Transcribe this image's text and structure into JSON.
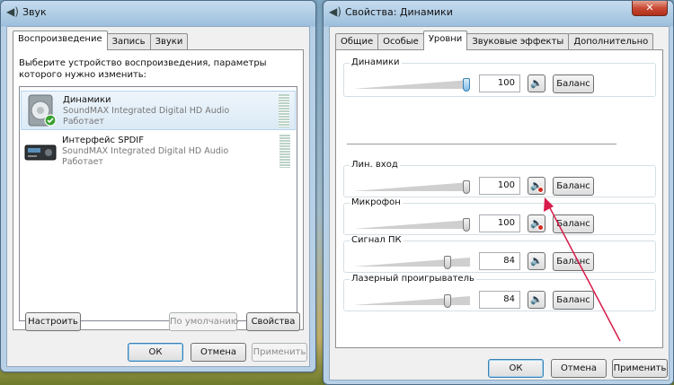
{
  "sound_dialog": {
    "title": "Звук",
    "close_glyph": "✕",
    "tabs": [
      "Воспроизведение",
      "Запись",
      "Звуки"
    ],
    "prompt": "Выберите устройство воспроизведения, параметры которого нужно изменить:",
    "devices": [
      {
        "name": "Динамики",
        "driver": "SoundMAX Integrated Digital HD Audio",
        "status": "Работает",
        "icon": "speaker-icon",
        "default_check": true
      },
      {
        "name": "Интерфейс SPDIF",
        "driver": "SoundMAX Integrated Digital HD Audio",
        "status": "Работает",
        "icon": "spdif-device-icon",
        "default_check": false
      }
    ],
    "configure_label": "Настроить",
    "default_label": "По умолчанию",
    "properties_label": "Свойства",
    "ok_label": "ОК",
    "cancel_label": "Отмена",
    "apply_label": "Применить"
  },
  "props_dialog": {
    "title": "Свойства: Динамики",
    "close_glyph": "✕",
    "tabs": [
      "Общие",
      "Особые",
      "Уровни",
      "Звуковые эффекты",
      "Дополнительно"
    ],
    "active_tab": 2,
    "levels": [
      {
        "label": "Динамики",
        "value": "100",
        "level": 1.0,
        "muted": false,
        "balance": "Баланс"
      },
      {
        "label": "Лин. вход",
        "value": "100",
        "level": 1.0,
        "muted": true,
        "balance": "Баланс"
      },
      {
        "label": "Микрофон",
        "value": "100",
        "level": 1.0,
        "muted": true,
        "balance": "Баланс"
      },
      {
        "label": "Сигнал ПК",
        "value": "84",
        "level": 0.84,
        "muted": false,
        "balance": "Баланс"
      },
      {
        "label": "Лазерный проигрыватель",
        "value": "84",
        "level": 0.84,
        "muted": false,
        "balance": "Баланс"
      }
    ],
    "ok_label": "ОК",
    "cancel_label": "Отмена",
    "apply_label": "Применить"
  },
  "annotation": {
    "color": "#d81b4a"
  },
  "speaker_glyph": "🔈"
}
